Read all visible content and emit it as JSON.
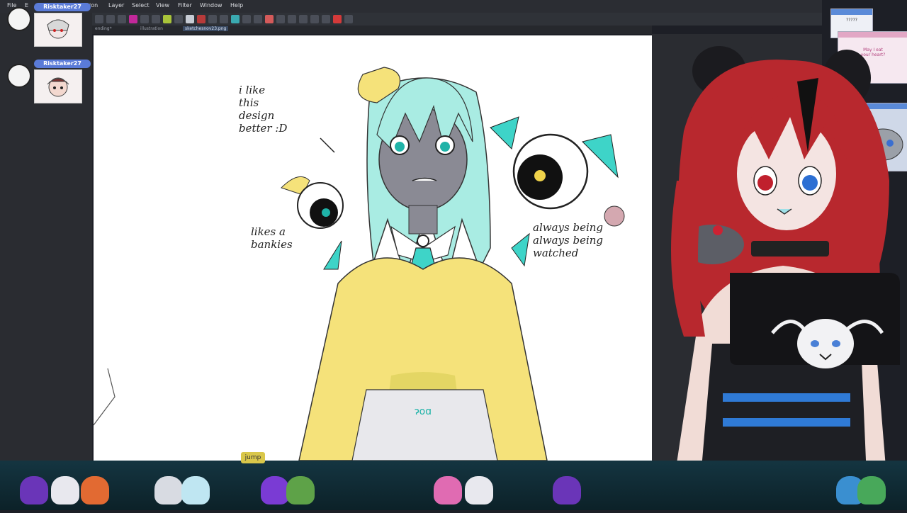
{
  "menu": [
    "File",
    "E",
    "ation",
    "Layer",
    "Select",
    "View",
    "Filter",
    "Window",
    "Help"
  ],
  "tabs": [
    "ending*",
    "illustration",
    "sketchesnov23.png"
  ],
  "chat": [
    {
      "user": "Risktaker27"
    },
    {
      "user": "Risktaker27"
    }
  ],
  "annotations": {
    "top_left": "i like\nthis\ndesign\nbetter :D",
    "left": "likes a\nbankies",
    "right": "always being\nalways being\nwatched"
  },
  "popups": {
    "small_title": "?????",
    "heart_text": "May I eat\nyour heart?"
  },
  "bottom_label": "jump",
  "colors": {
    "accent": "#5a7bd8",
    "hair_mint": "#9fe8e0",
    "sweater": "#f5e27a",
    "vtuber_hair": "#b8282e"
  }
}
